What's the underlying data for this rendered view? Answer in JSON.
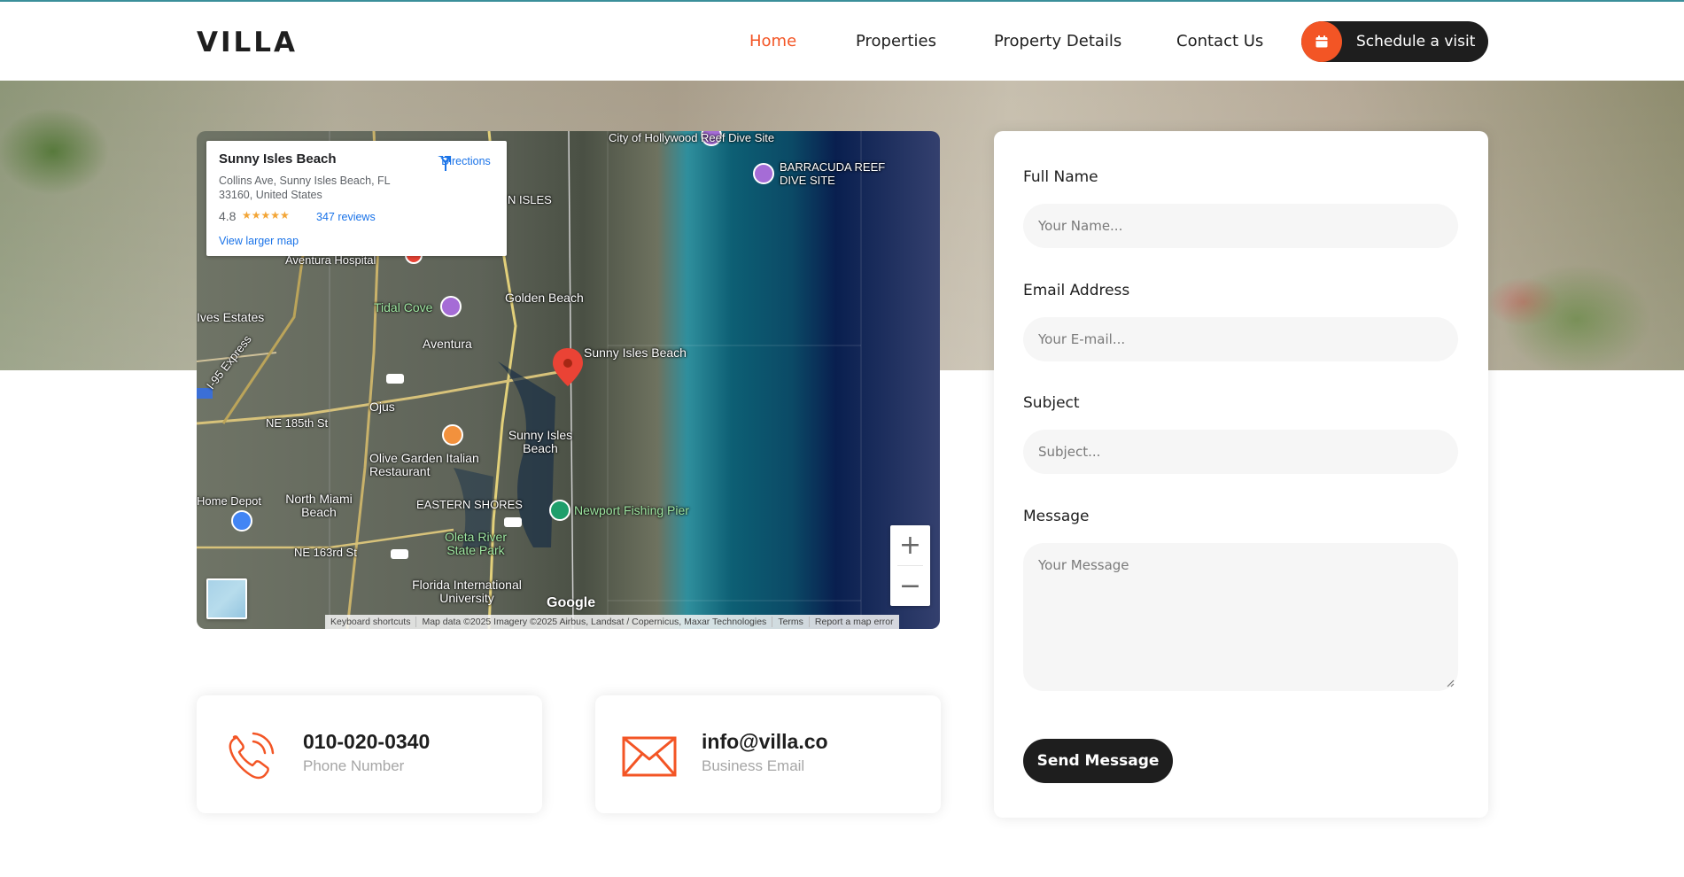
{
  "brand": {
    "logo": "VILLA",
    "accent": "#f35525",
    "dark": "#1e1e1e"
  },
  "nav": {
    "items": [
      {
        "label": "Home",
        "active": true
      },
      {
        "label": "Properties",
        "active": false
      },
      {
        "label": "Property Details",
        "active": false
      },
      {
        "label": "Contact Us",
        "active": false
      }
    ],
    "cta_label": "Schedule a visit",
    "cta_icon": "calendar-icon"
  },
  "map": {
    "place_name": "Sunny Isles Beach",
    "address": "Collins Ave, Sunny Isles Beach, FL 33160, United States",
    "rating": "4.8",
    "stars": "★★★★★",
    "reviews": "347 reviews",
    "view_larger": "View larger map",
    "directions": "Directions",
    "labels": {
      "reef_dive_site": "City of Hollywood Reef Dive Site",
      "barracuda": "BARRACUDA REEF DIVE SITE",
      "golden_beach": "Golden Beach",
      "ives_estates": "Ives Estates",
      "tidal_cove": "Tidal Cove",
      "aventura": "Aventura",
      "aventura_hospital": "Aventura Hospital",
      "sunny_isles_pin": "Sunny Isles Beach",
      "ojus": "Ojus",
      "ne185": "NE 185th St",
      "sunny_isles_beach2": "Sunny Isles Beach",
      "olive_garden": "Olive Garden Italian Restaurant",
      "eastern_shores": "EASTERN SHORES",
      "home_depot": "Home Depot",
      "north_miami": "North Miami Beach",
      "newport": "Newport Fishing Pier",
      "oleta": "Oleta River State Park",
      "ne163": "NE 163rd St",
      "fiu": "Florida International University",
      "n_isles": "N ISLES",
      "i95": "I-95 Express"
    },
    "zoom_in": "+",
    "zoom_out": "−",
    "google": "Google",
    "attribution": [
      "Keyboard shortcuts",
      "Map data ©2025 Imagery ©2025 Airbus, Landsat / Copernicus, Maxar Technologies",
      "Terms",
      "Report a map error"
    ]
  },
  "contact": {
    "phone": {
      "value": "010-020-0340",
      "label": "Phone Number",
      "icon": "phone-icon"
    },
    "email": {
      "value": "info@villa.co",
      "label": "Business Email",
      "icon": "envelope-icon"
    }
  },
  "form": {
    "name_label": "Full Name",
    "name_placeholder": "Your Name...",
    "email_label": "Email Address",
    "email_placeholder": "Your E-mail...",
    "subject_label": "Subject",
    "subject_placeholder": "Subject...",
    "message_label": "Message",
    "message_placeholder": "Your Message",
    "submit": "Send Message"
  }
}
